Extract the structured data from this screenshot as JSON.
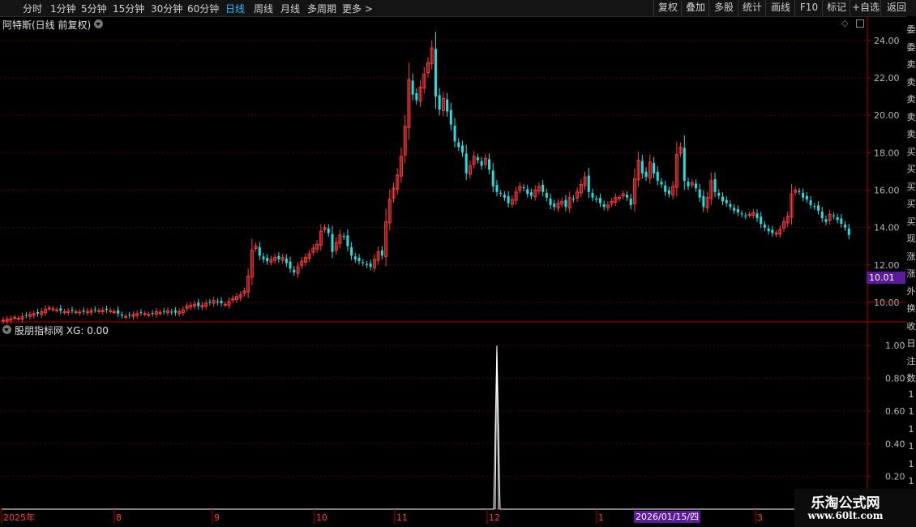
{
  "toolbar": {
    "periods": [
      "分时",
      "1分钟",
      "5分钟",
      "15分钟",
      "30分钟",
      "60分钟",
      "日线",
      "周线",
      "月线",
      "多周期",
      "更多 >"
    ],
    "active_period": "日线",
    "actions": [
      "复权",
      "叠加",
      "多股",
      "统计",
      "画线",
      "F10",
      "标记",
      "+自选",
      "返回"
    ]
  },
  "main_panel": {
    "title": "阿特斯(日线 前复权)"
  },
  "indicator_panel": {
    "title": "股朋指标网 XG: 0.00"
  },
  "price_badge": "10.01",
  "date_badge": "2026/01/15/四",
  "right_strip": [
    "委",
    "委",
    "卖",
    "卖",
    "卖",
    "卖",
    "卖",
    "买",
    "买",
    "买",
    "买",
    "买",
    "现",
    "涨",
    "涨",
    "外",
    "换",
    "收",
    "日",
    "注",
    "数",
    "1",
    "1",
    "1",
    "1",
    "1",
    "1",
    "1",
    "1"
  ],
  "watermark": {
    "title": "乐淘公式网",
    "url": "www.60lt.com"
  },
  "colors": {
    "up": "#ff3b3b",
    "down": "#22e0e0",
    "axis": "#b00000",
    "grid": "#5a0000",
    "signal": "#ffffff",
    "active_tab": "#2fb6ff"
  },
  "chart_data": [
    {
      "type": "candlestick",
      "title": "阿特斯(日线 前复权)",
      "ylim": [
        9,
        24.6
      ],
      "yticks": [
        "24.00",
        "22.00",
        "20.00",
        "18.00",
        "16.00",
        "14.00",
        "12.00",
        "10.00"
      ],
      "x_labels": [
        "2025年",
        "8",
        "9",
        "10",
        "11",
        "12",
        "1",
        "2026/01/15/四",
        "3"
      ],
      "close": [
        9.05,
        9.1,
        9.12,
        9.2,
        9.15,
        9.25,
        9.3,
        9.35,
        9.4,
        9.4,
        9.5,
        9.62,
        9.7,
        9.65,
        9.6,
        9.55,
        9.5,
        9.52,
        9.55,
        9.5,
        9.48,
        9.5,
        9.52,
        9.55,
        9.6,
        9.55,
        9.58,
        9.6,
        9.55,
        9.5,
        9.4,
        9.3,
        9.25,
        9.3,
        9.35,
        9.4,
        9.45,
        9.4,
        9.35,
        9.4,
        9.5,
        9.45,
        9.5,
        9.55,
        9.48,
        9.45,
        9.5,
        9.6,
        9.8,
        9.85,
        9.9,
        9.8,
        9.85,
        9.95,
        10.0,
        10.1,
        10.0,
        9.95,
        9.9,
        10.05,
        10.2,
        10.3,
        10.4,
        10.6,
        11.4,
        12.8,
        13.0,
        12.5,
        12.3,
        12.2,
        12.3,
        12.4,
        12.3,
        12.4,
        12.1,
        11.8,
        11.6,
        11.9,
        12.2,
        12.4,
        12.6,
        12.9,
        13.1,
        13.8,
        14.0,
        13.7,
        12.7,
        13.2,
        13.6,
        13.5,
        13.0,
        12.5,
        12.3,
        12.2,
        12.1,
        12.0,
        11.9,
        12.3,
        12.7,
        12.5,
        14.3,
        15.5,
        16.1,
        16.8,
        17.8,
        19.4,
        21.9,
        21.1,
        20.8,
        21.5,
        22.2,
        22.8,
        23.6,
        21.0,
        20.3,
        20.9,
        20.2,
        19.5,
        18.6,
        18.3,
        18.0,
        16.9,
        17.3,
        17.8,
        17.6,
        17.3,
        17.7,
        17.1,
        16.2,
        15.9,
        15.8,
        15.6,
        15.3,
        15.5,
        15.9,
        16.2,
        16.1,
        15.8,
        15.7,
        16.0,
        16.2,
        15.9,
        15.6,
        15.2,
        15.1,
        15.3,
        15.4,
        15.1,
        15.6,
        15.5,
        15.9,
        16.3,
        16.7,
        15.9,
        15.6,
        15.5,
        15.3,
        15.1,
        15.2,
        15.4,
        15.6,
        15.6,
        15.8,
        15.6,
        15.2,
        16.6,
        17.6,
        16.9,
        16.7,
        17.5,
        16.9,
        16.5,
        16.3,
        15.9,
        15.8,
        16.2,
        17.9,
        18.3,
        16.5,
        16.2,
        16.4,
        16.1,
        15.6,
        15.1,
        15.6,
        16.5,
        15.9,
        15.7,
        15.4,
        15.3,
        15.1,
        14.9,
        14.8,
        14.7,
        14.6,
        14.7,
        14.8,
        14.5,
        14.2,
        14.0,
        13.8,
        13.7,
        13.7,
        13.9,
        14.3,
        14.6,
        15.8,
        16.0,
        15.9,
        15.6,
        15.5,
        15.2,
        15.1,
        14.9,
        14.5,
        14.3,
        14.7,
        14.6,
        14.4,
        14.2,
        14.0,
        13.6
      ],
      "price_marker": 10.01
    },
    {
      "type": "line",
      "title": "股朋指标网 XG: 0.00",
      "ylim": [
        0,
        1.1
      ],
      "yticks": [
        "1.00",
        "0.80",
        "0.60",
        "0.40",
        "0.20"
      ],
      "series": [
        {
          "name": "XG",
          "signal_bar_index": 129,
          "peak": 1.0,
          "last": 0.0
        }
      ]
    }
  ]
}
